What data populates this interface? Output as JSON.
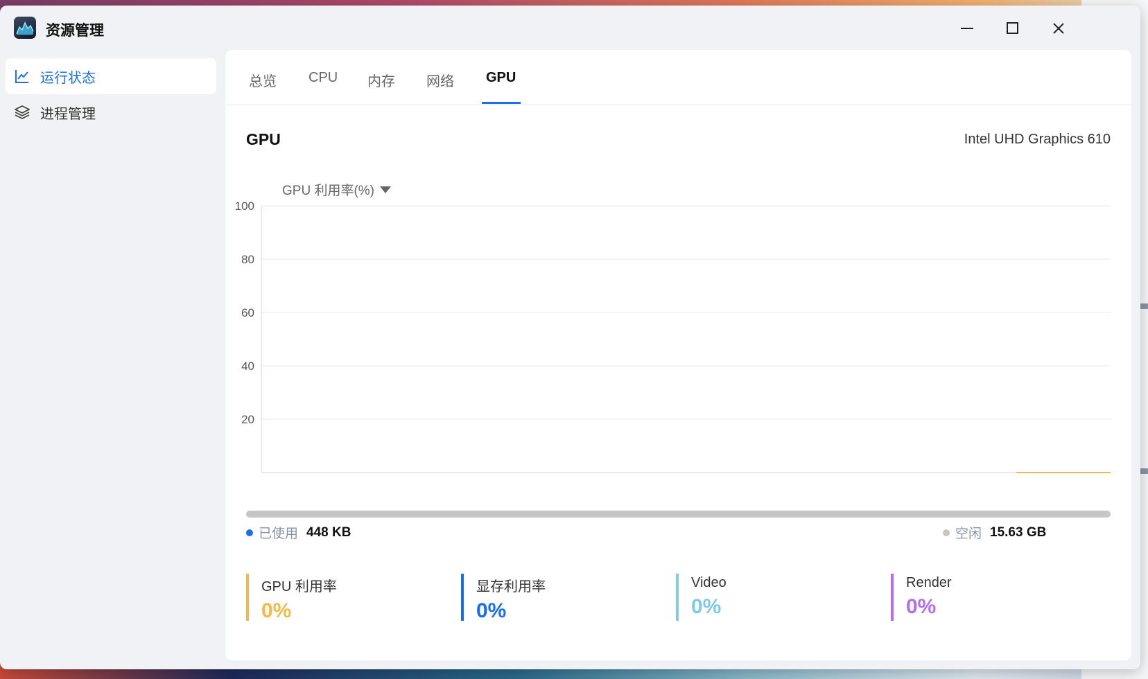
{
  "app": {
    "title": "资源管理"
  },
  "window_controls": {
    "minimize": "minimize",
    "maximize": "maximize",
    "close": "close"
  },
  "sidebar": {
    "items": [
      {
        "label": "运行状态",
        "icon": "line-chart-icon",
        "active": true
      },
      {
        "label": "进程管理",
        "icon": "layers-icon",
        "active": false
      }
    ]
  },
  "tabs": [
    {
      "label": "总览",
      "active": false
    },
    {
      "label": "CPU",
      "active": false
    },
    {
      "label": "内存",
      "active": false
    },
    {
      "label": "网络",
      "active": false
    },
    {
      "label": "GPU",
      "active": true
    }
  ],
  "gpu": {
    "section_title": "GPU",
    "device_name": "Intel UHD Graphics 610",
    "metric_selector": "GPU 利用率(%)"
  },
  "chart_data": {
    "type": "line",
    "ylim": [
      0,
      100
    ],
    "yticks": [
      "100",
      "80",
      "60",
      "40",
      "20"
    ],
    "grid": true,
    "series": [
      {
        "color": "#f5b94a",
        "values": [
          0,
          0,
          0,
          0,
          0,
          0,
          0,
          0,
          0,
          0
        ]
      }
    ]
  },
  "memory": {
    "used_label": "已使用",
    "used_value": "448 KB",
    "free_label": "空闲",
    "free_value": "15.63 GB",
    "used_color": "#1a6cf0",
    "free_color": "#c6c6c6"
  },
  "stats": [
    {
      "label": "GPU 利用率",
      "value": "0%",
      "color": "#f5b94a"
    },
    {
      "label": "显存利用率",
      "value": "0%",
      "color": "#1a6cf0"
    },
    {
      "label": "Video",
      "value": "0%",
      "color": "#7fcbe6"
    },
    {
      "label": "Render",
      "value": "0%",
      "color": "#b36ef0"
    }
  ],
  "colors": {
    "accent": "#1a6cf0"
  }
}
